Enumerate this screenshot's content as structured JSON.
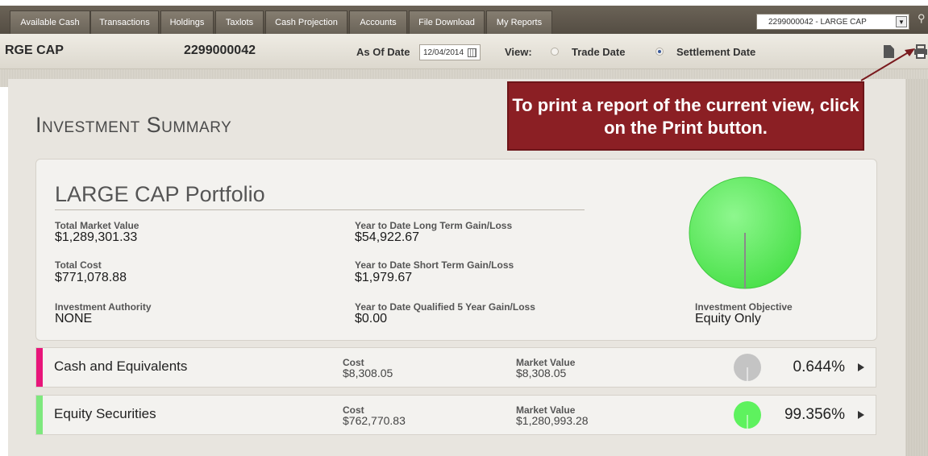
{
  "tabs": [
    {
      "label": "Available Cash"
    },
    {
      "label": "Transactions"
    },
    {
      "label": "Holdings"
    },
    {
      "label": "Taxlots"
    },
    {
      "label": "Cash Projection"
    },
    {
      "label": "Accounts"
    },
    {
      "label": "File Download"
    },
    {
      "label": "My Reports"
    }
  ],
  "account_select": {
    "value": "2299000042 - LARGE CAP"
  },
  "header": {
    "account_name": "RGE CAP",
    "account_number": "2299000042",
    "as_of_label": "As Of Date",
    "as_of_value": "12/04/2014",
    "view_label": "View:",
    "trade_date_label": "Trade Date",
    "settlement_date_label": "Settlement Date",
    "selected_view": "Settlement Date"
  },
  "page_title": "Investment Summary",
  "tooltip": {
    "text": "To print a report of the current view, click on the Print button."
  },
  "portfolio": {
    "title": "LARGE CAP Portfolio",
    "total_market_value_label": "Total Market Value",
    "total_market_value": "$1,289,301.33",
    "total_cost_label": "Total Cost",
    "total_cost": "$771,078.88",
    "investment_authority_label": "Investment Authority",
    "investment_authority": "NONE",
    "ytd_long_label": "Year to Date Long Term Gain/Loss",
    "ytd_long": "$54,922.67",
    "ytd_short_label": "Year to Date Short Term Gain/Loss",
    "ytd_short": "$1,979.67",
    "ytd_q5_label": "Year to Date Qualified 5 Year Gain/Loss",
    "ytd_q5": "$0.00",
    "objective_label": "Investment Objective",
    "objective": "Equity Only"
  },
  "asset_classes": [
    {
      "name": "Cash and Equivalents",
      "cost_label": "Cost",
      "cost": "$8,308.05",
      "market_value_label": "Market Value",
      "market_value": "$8,308.05",
      "percent": "0.644%",
      "color": "#e8157a"
    },
    {
      "name": "Equity Securities",
      "cost_label": "Cost",
      "cost": "$762,770.83",
      "market_value_label": "Market Value",
      "market_value": "$1,280,993.28",
      "percent": "99.356%",
      "color": "#7ee87e"
    }
  ],
  "colors": {
    "tab_bar": "#5f584d",
    "tooltip_bg": "#8b1f24",
    "pie_green": "#5ef25e",
    "pie_gray": "#c4c4c4"
  }
}
